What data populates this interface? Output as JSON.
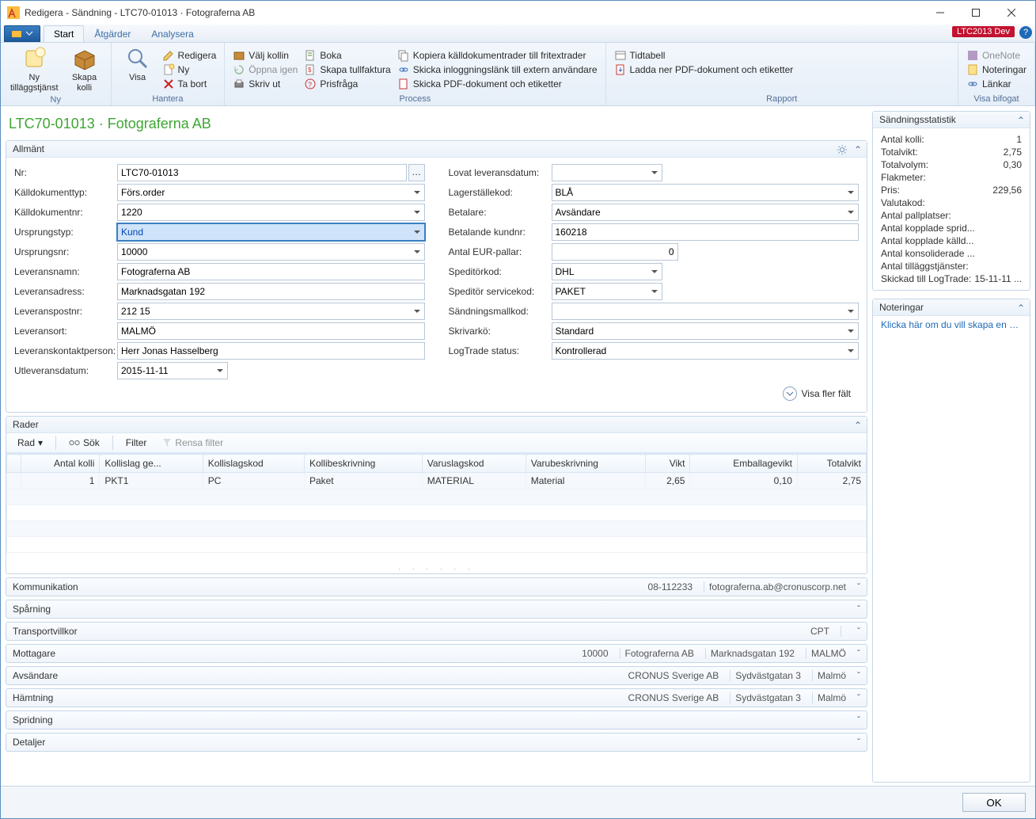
{
  "window": {
    "title": "Redigera - Sändning - LTC70-01013 · Fotograferna AB"
  },
  "envBadge": "LTC2013 Dev",
  "tabs": [
    "Start",
    "Åtgärder",
    "Analysera"
  ],
  "ribbon": {
    "groups": [
      {
        "label": "Ny",
        "big": [
          {
            "label": "Ny\ntilläggstjänst",
            "icon": "new-service-icon"
          },
          {
            "label": "Skapa\nkolli",
            "icon": "create-package-icon"
          }
        ]
      },
      {
        "label": "Hantera",
        "big": [
          {
            "label": "Visa",
            "icon": "view-icon"
          }
        ],
        "rows": [
          {
            "label": "Redigera",
            "icon": "edit-icon"
          },
          {
            "label": "Ny",
            "icon": "new-icon"
          },
          {
            "label": "Ta bort",
            "icon": "delete-icon"
          }
        ]
      },
      {
        "label": "Process",
        "rows1": [
          {
            "label": "Välj kollin",
            "icon": "select-packages-icon"
          },
          {
            "label": "Öppna igen",
            "icon": "reopen-icon"
          },
          {
            "label": "Skriv ut",
            "icon": "print-icon"
          }
        ],
        "rows2": [
          {
            "label": "Boka",
            "icon": "book-icon"
          },
          {
            "label": "Skapa tullfaktura",
            "icon": "customs-invoice-icon"
          },
          {
            "label": "Prisfråga",
            "icon": "price-query-icon"
          }
        ],
        "rows3": [
          {
            "label": "Kopiera källdokumentrader till fritextrader",
            "icon": "copy-lines-icon"
          },
          {
            "label": "Skicka inloggningslänk till extern användare",
            "icon": "send-link-icon"
          },
          {
            "label": "Skicka PDF-dokument och etiketter",
            "icon": "send-pdf-icon"
          }
        ]
      },
      {
        "label": "Rapport",
        "rows": [
          {
            "label": "Tidtabell",
            "icon": "timetable-icon"
          },
          {
            "label": "Ladda ner PDF-dokument och etiketter",
            "icon": "download-pdf-icon"
          }
        ]
      },
      {
        "label": "Visa bifogat",
        "rows": [
          {
            "label": "OneNote",
            "icon": "onenote-icon"
          },
          {
            "label": "Noteringar",
            "icon": "notes-icon"
          },
          {
            "label": "Länkar",
            "icon": "links-icon"
          }
        ]
      }
    ]
  },
  "recordTitle": "LTC70-01013 · Fotograferna AB",
  "general": {
    "caption": "Allmänt",
    "nr": "LTC70-01013",
    "kalldokumenttyp": "Förs.order",
    "kalldokumentnr": "1220",
    "ursprungstyp": "Kund",
    "ursprungsnr": "10000",
    "leveransnamn": "Fotograferna AB",
    "leveransadress": "Marknadsgatan 192",
    "leveranspostnr": "212 15",
    "leveransort": "MALMÖ",
    "leveranskontakt": "Herr Jonas Hasselberg",
    "utleveransdatum": "2015-11-11",
    "lovat_leveransdatum": "",
    "lagerstallekod": "BLÅ",
    "betalare": "Avsändare",
    "betalande_kundnr": "160218",
    "antal_eurpallar": "0",
    "speditorkod": "DHL",
    "speditor_servicekod": "PAKET",
    "sandningsmallkod": "",
    "skrivarko": "Standard",
    "logtrade_status": "Kontrollerad",
    "showMore": "Visa fler fält",
    "labels": {
      "nr": "Nr:",
      "kalldokumenttyp": "Källdokumenttyp:",
      "kalldokumentnr": "Källdokumentnr:",
      "ursprungstyp": "Ursprungstyp:",
      "ursprungsnr": "Ursprungsnr:",
      "leveransnamn": "Leveransnamn:",
      "leveransadress": "Leveransadress:",
      "leveranspostnr": "Leveranspostnr:",
      "leveransort": "Leveransort:",
      "leveranskontakt": "Leveranskontaktperson:",
      "utleveransdatum": "Utleveransdatum:",
      "lovat": "Lovat leveransdatum:",
      "lagerstalle": "Lagerställekod:",
      "betalare": "Betalare:",
      "betalande": "Betalande kundnr:",
      "eurpallar": "Antal EUR-pallar:",
      "speditor": "Speditörkod:",
      "service": "Speditör servicekod:",
      "mall": "Sändningsmallkod:",
      "skrivarko": "Skrivarkö:",
      "logtrade": "LogTrade status:"
    }
  },
  "lines": {
    "caption": "Rader",
    "toolbar": {
      "rad": "Rad",
      "sok": "Sök",
      "filter": "Filter",
      "rensa": "Rensa filter"
    },
    "columns": [
      "Antal kolli",
      "Kollislag ge...",
      "Kollislagskod",
      "Kollibeskrivning",
      "Varuslagskod",
      "Varubeskrivning",
      "Vikt",
      "Emballagevikt",
      "Totalvikt"
    ],
    "rows": [
      {
        "antal": "1",
        "kollislag_gen": "PKT1",
        "kollislagskod": "PC",
        "kollibeskr": "Paket",
        "varuslagskod": "MATERIAL",
        "varubeskr": "Material",
        "vikt": "2,65",
        "emb": "0,10",
        "total": "2,75"
      }
    ]
  },
  "fastTabs": [
    {
      "title": "Kommunikation",
      "summary": [
        "08-112233",
        "fotograferna.ab@cronuscorp.net"
      ]
    },
    {
      "title": "Spårning",
      "summary": []
    },
    {
      "title": "Transportvillkor",
      "summary": [
        "CPT",
        ""
      ]
    },
    {
      "title": "Mottagare",
      "summary": [
        "10000",
        "Fotograferna AB",
        "Marknadsgatan 192",
        "MALMÖ"
      ]
    },
    {
      "title": "Avsändare",
      "summary": [
        "CRONUS Sverige AB",
        "Sydvästgatan 3",
        "Malmö"
      ]
    },
    {
      "title": "Hämtning",
      "summary": [
        "CRONUS Sverige AB",
        "Sydvästgatan 3",
        "Malmö"
      ]
    },
    {
      "title": "Spridning",
      "summary": []
    },
    {
      "title": "Detaljer",
      "summary": []
    }
  ],
  "stats": {
    "caption": "Sändningsstatistik",
    "rows": [
      {
        "l": "Antal kolli:",
        "v": "1"
      },
      {
        "l": "Totalvikt:",
        "v": "2,75"
      },
      {
        "l": "Totalvolym:",
        "v": "0,30"
      },
      {
        "l": "Flakmeter:",
        "v": ""
      },
      {
        "l": "Pris:",
        "v": "229,56"
      },
      {
        "l": "Valutakod:",
        "v": ""
      },
      {
        "l": "Antal pallplatser:",
        "v": ""
      },
      {
        "l": "Antal kopplade sprid...",
        "v": ""
      },
      {
        "l": "Antal kopplade källd...",
        "v": ""
      },
      {
        "l": "Antal konsoliderade ...",
        "v": ""
      },
      {
        "l": "Antal tilläggstjänster:",
        "v": ""
      },
      {
        "l": "Skickad till LogTrade:",
        "v": "15-11-11 ..."
      }
    ]
  },
  "notes": {
    "caption": "Noteringar",
    "link": "Klicka här om du vill skapa en ny an..."
  },
  "footer": {
    "ok": "OK"
  }
}
